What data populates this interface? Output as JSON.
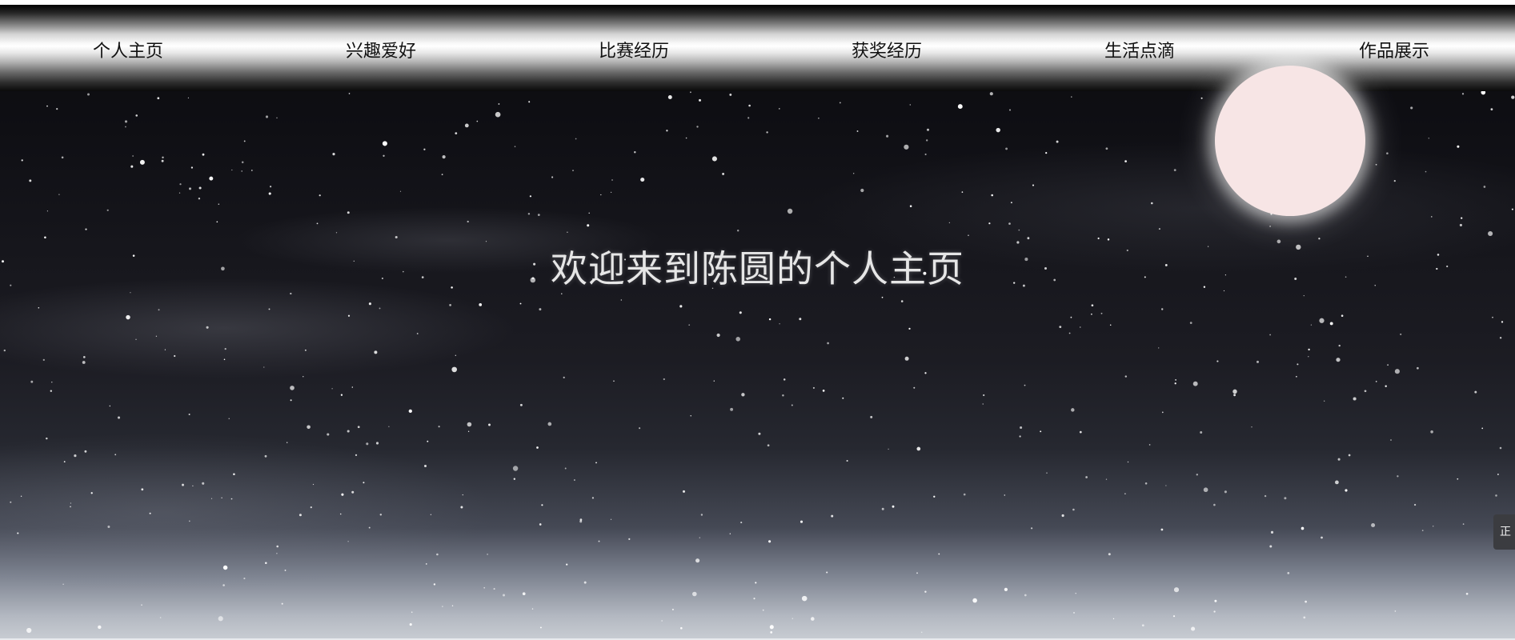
{
  "nav": {
    "items": [
      {
        "label": "个人主页"
      },
      {
        "label": "兴趣爱好"
      },
      {
        "label": "比赛经历"
      },
      {
        "label": "获奖经历"
      },
      {
        "label": "生活点滴"
      },
      {
        "label": "作品展示"
      }
    ]
  },
  "hero": {
    "title": "欢迎来到陈圆的个人主页"
  },
  "side_tab": {
    "label": "正"
  },
  "colors": {
    "moon": "#f7e5e5",
    "nav_text": "#111111",
    "title_text": "#e6e6e6",
    "sky_top": "#0b0b0f",
    "sky_bottom": "#c9cdd3"
  }
}
